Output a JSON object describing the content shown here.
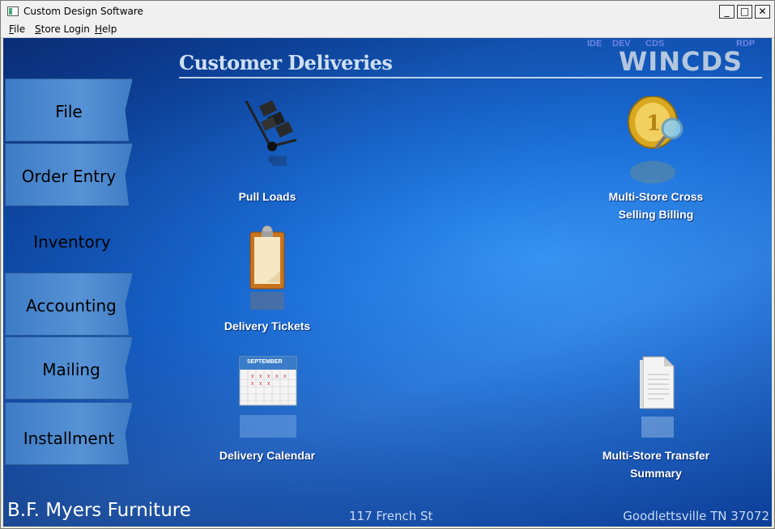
{
  "window": {
    "title": "Custom Design Software",
    "controls": [
      "_",
      "□",
      "✕"
    ]
  },
  "menu": [
    {
      "hot": "F",
      "rest": "ile"
    },
    {
      "hot": "S",
      "rest": "tore Login"
    },
    {
      "hot": "H",
      "rest": "elp"
    }
  ],
  "header": {
    "title": "Customer Deliveries",
    "env_tags": [
      "IDE",
      "DEV",
      "CDS",
      "RDP"
    ],
    "brand": "WINCDS"
  },
  "tabs": [
    {
      "label": "File",
      "active": false
    },
    {
      "label": "Order Entry",
      "active": false
    },
    {
      "label": "Inventory",
      "active": true
    },
    {
      "label": "Accounting",
      "active": false
    },
    {
      "label": "Mailing",
      "active": false
    },
    {
      "label": "Installment",
      "active": false
    }
  ],
  "tools": {
    "pull_loads": {
      "line1": "Pull Loads",
      "icon": "hand-truck-icon"
    },
    "delivery_tickets": {
      "line1": "Delivery Tickets",
      "icon": "clipboard-icon"
    },
    "delivery_calendar": {
      "line1": "Delivery Calendar",
      "icon": "calendar-icon",
      "month": "SEPTEMBER"
    },
    "cross_selling": {
      "line1": "Multi-Store Cross",
      "line2": "Selling Billing",
      "icon": "coin-magnifier-icon"
    },
    "transfer_summary": {
      "line1": "Multi-Store Transfer",
      "line2": "Summary",
      "icon": "document-icon"
    }
  },
  "footer": {
    "store": "B.F. Myers Furniture",
    "address": "117 French St",
    "city": "Goodlettsville TN 37072"
  },
  "colors": {
    "background": "#1b6fd8",
    "tab": "#5792d6",
    "accent": "#b4c7de"
  }
}
